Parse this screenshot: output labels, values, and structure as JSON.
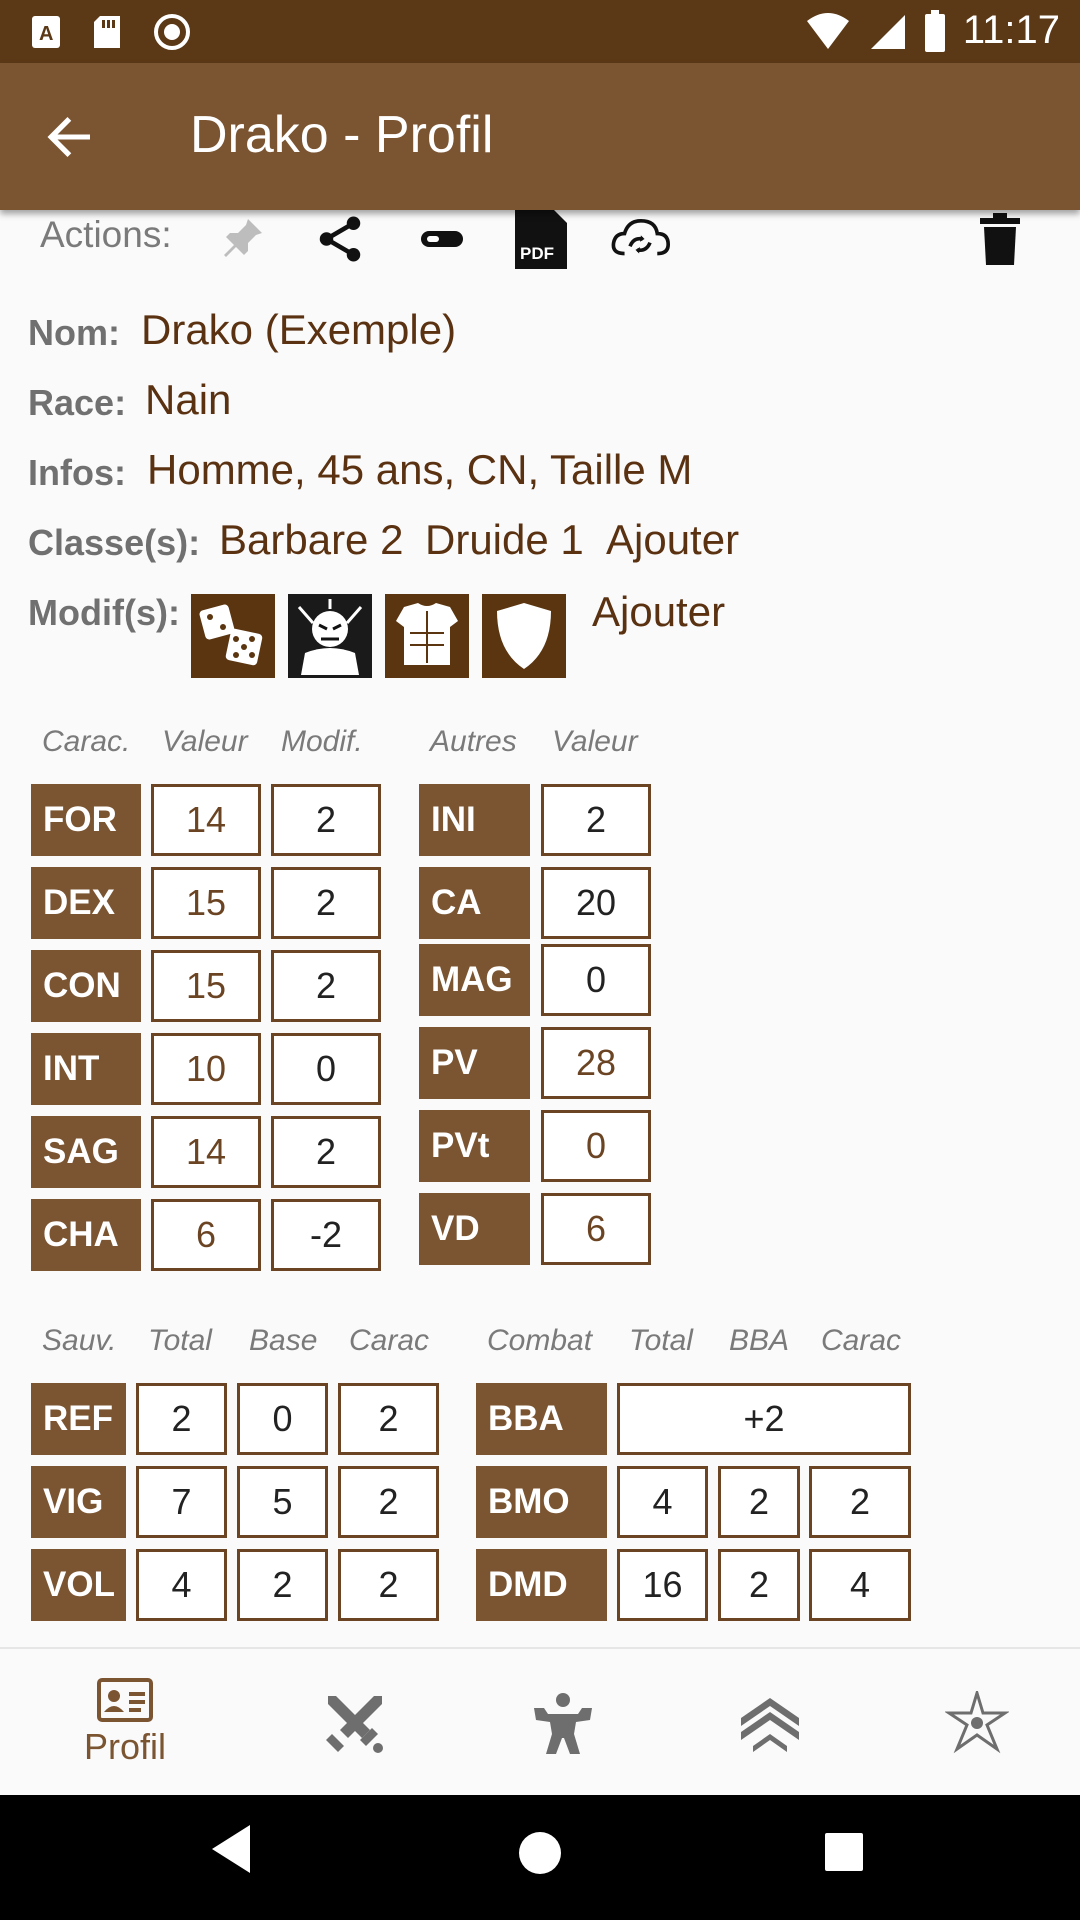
{
  "status": {
    "time": "11:17"
  },
  "app": {
    "title": "Drako - Profil"
  },
  "actions": {
    "label": "Actions:"
  },
  "info": {
    "nom_label": "Nom:",
    "nom": "Drako (Exemple)",
    "race_label": "Race:",
    "race": "Nain",
    "infos_label": "Infos:",
    "infos": "Homme, 45 ans, CN, Taille M",
    "classes_label": "Classe(s):",
    "class1": "Barbare 2",
    "class2": "Druide 1",
    "class_add": "Ajouter",
    "modifs_label": "Modif(s):",
    "modif_add": "Ajouter"
  },
  "carac": {
    "headers": [
      "Carac.",
      "Valeur",
      "Modif."
    ],
    "rows": [
      {
        "name": "FOR",
        "value": "14",
        "mod": "2"
      },
      {
        "name": "DEX",
        "value": "15",
        "mod": "2"
      },
      {
        "name": "CON",
        "value": "15",
        "mod": "2"
      },
      {
        "name": "INT",
        "value": "10",
        "mod": "0"
      },
      {
        "name": "SAG",
        "value": "14",
        "mod": "2"
      },
      {
        "name": "CHA",
        "value": "6",
        "mod": "-2"
      }
    ]
  },
  "autres": {
    "headers": [
      "Autres",
      "Valeur"
    ],
    "rows": [
      {
        "name": "INI",
        "value": "2"
      },
      {
        "name": "CA",
        "value": "20"
      },
      {
        "name": "MAG",
        "value": "0"
      },
      {
        "name": "PV",
        "value": "28"
      },
      {
        "name": "PVt",
        "value": "0"
      },
      {
        "name": "VD",
        "value": "6"
      }
    ]
  },
  "sauv": {
    "headers": [
      "Sauv.",
      "Total",
      "Base",
      "Carac"
    ],
    "rows": [
      {
        "name": "REF",
        "total": "2",
        "base": "0",
        "carac": "2"
      },
      {
        "name": "VIG",
        "total": "7",
        "base": "5",
        "carac": "2"
      },
      {
        "name": "VOL",
        "total": "4",
        "base": "2",
        "carac": "2"
      }
    ]
  },
  "combat": {
    "headers": [
      "Combat",
      "Total",
      "BBA",
      "Carac"
    ],
    "bba_name": "BBA",
    "bba_value": "+2",
    "rows": [
      {
        "name": "BMO",
        "total": "4",
        "bba": "2",
        "carac": "2"
      },
      {
        "name": "DMD",
        "total": "16",
        "bba": "2",
        "carac": "4"
      }
    ]
  },
  "nav": {
    "profil_label": "Profil"
  },
  "colors": {
    "brown": "#7b5532",
    "dark_brown": "#5b3917",
    "text_brown": "#5a3212"
  }
}
